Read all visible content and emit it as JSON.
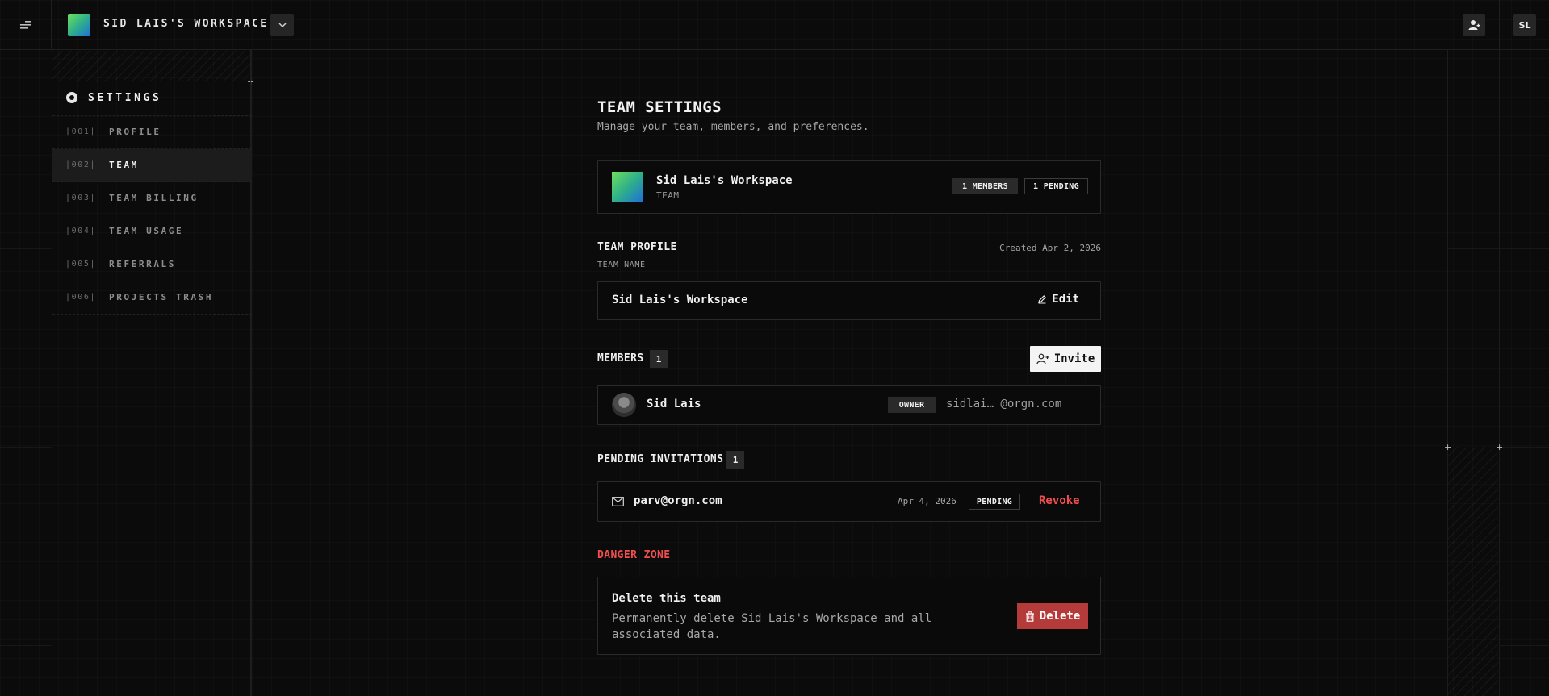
{
  "topbar": {
    "workspace_name": "SID LAIS'S WORKSPACE",
    "avatar_initials": "SL",
    "menu_icon": "menu-icon",
    "dropdown_icon": "chevron-down-icon",
    "invite_icon": "user-plus-icon"
  },
  "sidebar": {
    "heading": "SETTINGS",
    "items": [
      {
        "num": "|001|",
        "label": "PROFILE",
        "active": false
      },
      {
        "num": "|002|",
        "label": "TEAM",
        "active": true
      },
      {
        "num": "|003|",
        "label": "TEAM BILLING",
        "active": false
      },
      {
        "num": "|004|",
        "label": "TEAM USAGE",
        "active": false
      },
      {
        "num": "|005|",
        "label": "REFERRALS",
        "active": false
      },
      {
        "num": "|006|",
        "label": "PROJECTS TRASH",
        "active": false
      }
    ]
  },
  "main": {
    "title": "TEAM SETTINGS",
    "subtitle": "Manage your team, members, and preferences.",
    "workspace_card": {
      "name": "Sid Lais's Workspace",
      "type": "TEAM",
      "members_badge": "1 MEMBERS",
      "pending_badge": "1 PENDING"
    },
    "team_profile": {
      "title": "TEAM PROFILE",
      "created": "Created Apr 2, 2026",
      "field_label": "TEAM NAME",
      "field_value": "Sid Lais's Workspace",
      "edit_label": "Edit"
    },
    "members": {
      "title": "MEMBERS",
      "count": "1",
      "invite_label": "Invite",
      "list": [
        {
          "name": "Sid Lais",
          "role": "OWNER",
          "email": "sidlai… @orgn.com"
        }
      ]
    },
    "pending": {
      "title": "PENDING INVITATIONS",
      "count": "1",
      "list": [
        {
          "email": "parv@orgn.com",
          "date": "Apr 4, 2026",
          "status": "PENDING",
          "action": "Revoke"
        }
      ]
    },
    "danger": {
      "title": "DANGER ZONE",
      "delete_title": "Delete this team",
      "delete_desc": "Permanently delete Sid Lais's Workspace and all associated data.",
      "delete_label": "Delete"
    }
  },
  "colors": {
    "background": "#0b0b0b",
    "danger": "#f04e4e",
    "danger_button": "#b53a3a",
    "badge_bg": "#2a2a2a"
  }
}
